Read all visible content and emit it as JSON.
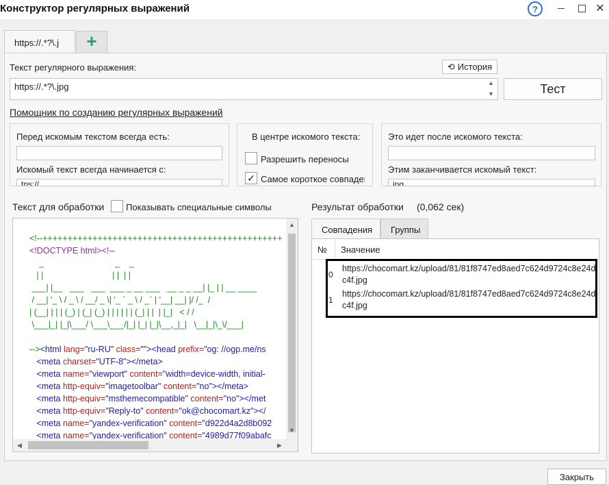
{
  "window": {
    "title": "Конструктор регулярных выражений"
  },
  "tabs": {
    "main_label": "https://.*?\\.j",
    "add_label": "+"
  },
  "regex": {
    "label": "Текст регулярного выражения:",
    "history_label": "История",
    "value": "https://.*?\\.jpg",
    "test_label": "Тест",
    "helper_link": "Помощник по созданию регулярных выражений"
  },
  "helper": {
    "before_label": "Перед искомым текстом всегда есть:",
    "before_value": "",
    "starts_label": "Искомый текст всегда начинается с:",
    "starts_value": "tps://",
    "center_label": "В центре искомого текста:",
    "allow_wrap_label": "Разрешить переносы",
    "allow_wrap_checked": false,
    "shortest_label": "Самое короткое совпаден",
    "shortest_checked": true,
    "after_label": "Это идет после искомого текста:",
    "after_value": "",
    "ends_label": "Этим заканчивается искомый текст:",
    "ends_value": "jpg"
  },
  "source": {
    "label": "Текст для обработки",
    "show_special_label": "Показывать специальные символы",
    "show_special_checked": false,
    "lines": [
      [
        {
          "t": "<!--++++++++++++++++++++++++++++++++++++++++++++++++",
          "c": "green"
        }
      ],
      [
        {
          "t": "<!DOCTYPE ",
          "c": "mag"
        },
        {
          "t": "html",
          "c": "mag"
        },
        {
          "t": "><!--",
          "c": "mag"
        }
      ],
      [
        {
          "t": "    _                              _    _",
          "c": "green"
        }
      ],
      [
        {
          "t": "   | |                             | |  | |",
          "c": "green"
        }
      ],
      [
        {
          "t": " ___| |__   ___   ___  ___ _ __ ___   __ _ _ __| |_ | | __ ____",
          "c": "green"
        }
      ],
      [
        {
          "t": " / __| '_ \\ / _ \\ / __/ _ \\| '_ ` _ \\ / _` | '__| __| |/ /_  /",
          "c": "green"
        }
      ],
      [
        {
          "t": "| (__| | | | (_) | (_| (_) | | | | | | (_| | |  | |_|   < / /",
          "c": "green"
        }
      ],
      [
        {
          "t": " \\___|_| |_|\\___/ \\___\\___/|_| |_| |_|\\__,_|_|   \\__|_|\\_\\/___|",
          "c": "green"
        }
      ],
      [
        {
          "t": "",
          "c": "black"
        }
      ],
      [
        {
          "t": "-->",
          "c": "green"
        },
        {
          "t": "<html ",
          "c": "blue"
        },
        {
          "t": "lang=",
          "c": "red"
        },
        {
          "t": "\"ru-RU\" ",
          "c": "blue"
        },
        {
          "t": "class=",
          "c": "red"
        },
        {
          "t": "\"\">",
          "c": "blue"
        },
        {
          "t": "<head ",
          "c": "blue"
        },
        {
          "t": "prefix=",
          "c": "red"
        },
        {
          "t": "\"og: //ogp.me/ns",
          "c": "blue"
        }
      ],
      [
        {
          "t": "   <meta ",
          "c": "blue"
        },
        {
          "t": "charset=",
          "c": "red"
        },
        {
          "t": "\"UTF-8\">",
          "c": "blue"
        },
        {
          "t": "</meta>",
          "c": "blue"
        }
      ],
      [
        {
          "t": "   <meta ",
          "c": "blue"
        },
        {
          "t": "name=",
          "c": "red"
        },
        {
          "t": "\"viewport\" ",
          "c": "blue"
        },
        {
          "t": "content=",
          "c": "red"
        },
        {
          "t": "\"width=device-width, initial-",
          "c": "blue"
        }
      ],
      [
        {
          "t": "   <meta ",
          "c": "blue"
        },
        {
          "t": "http-equiv=",
          "c": "red"
        },
        {
          "t": "\"imagetoolbar\" ",
          "c": "blue"
        },
        {
          "t": "content=",
          "c": "red"
        },
        {
          "t": "\"no\">",
          "c": "blue"
        },
        {
          "t": "</meta>",
          "c": "blue"
        }
      ],
      [
        {
          "t": "   <meta ",
          "c": "blue"
        },
        {
          "t": "http-equiv=",
          "c": "red"
        },
        {
          "t": "\"msthemecompatible\" ",
          "c": "blue"
        },
        {
          "t": "content=",
          "c": "red"
        },
        {
          "t": "\"no\">",
          "c": "blue"
        },
        {
          "t": "</met",
          "c": "blue"
        }
      ],
      [
        {
          "t": "   <meta ",
          "c": "blue"
        },
        {
          "t": "http-equiv=",
          "c": "red"
        },
        {
          "t": "\"Reply-to\" ",
          "c": "blue"
        },
        {
          "t": "content=",
          "c": "red"
        },
        {
          "t": "\"ok@chocomart.kz\">",
          "c": "blue"
        },
        {
          "t": "</",
          "c": "blue"
        }
      ],
      [
        {
          "t": "   <meta ",
          "c": "blue"
        },
        {
          "t": "name=",
          "c": "red"
        },
        {
          "t": "\"yandex-verification\" ",
          "c": "blue"
        },
        {
          "t": "content=",
          "c": "red"
        },
        {
          "t": "\"d922d4a2d8b092",
          "c": "blue"
        }
      ],
      [
        {
          "t": "   <meta ",
          "c": "blue"
        },
        {
          "t": "name=",
          "c": "red"
        },
        {
          "t": "\"yandex-verification\" ",
          "c": "blue"
        },
        {
          "t": "content=",
          "c": "red"
        },
        {
          "t": "\"4989d77f09abafc",
          "c": "blue"
        }
      ]
    ]
  },
  "result": {
    "label": "Результат обработки",
    "time": "(0,062 сек)",
    "tab_matches": "Совпадения",
    "tab_groups": "Группы",
    "col_num": "№",
    "col_value": "Значение",
    "rows": [
      {
        "index": "0",
        "value": "https://chocomart.kz/upload/81/81f8747ed8aed7c624d9724c8e24dc4f.jpg"
      },
      {
        "index": "1",
        "value": "https://chocomart.kz/upload/81/81f8747ed8aed7c624d9724c8e24dc4f.jpg"
      }
    ]
  },
  "footer": {
    "close_label": "Закрыть"
  },
  "colors": {
    "accent_add": "#1aa37a",
    "help": "#2a6fc9",
    "code_green": "#1c8a1c",
    "code_magenta": "#b01ab0",
    "code_blue": "#1a1ab5",
    "code_red": "#c01a1a"
  }
}
